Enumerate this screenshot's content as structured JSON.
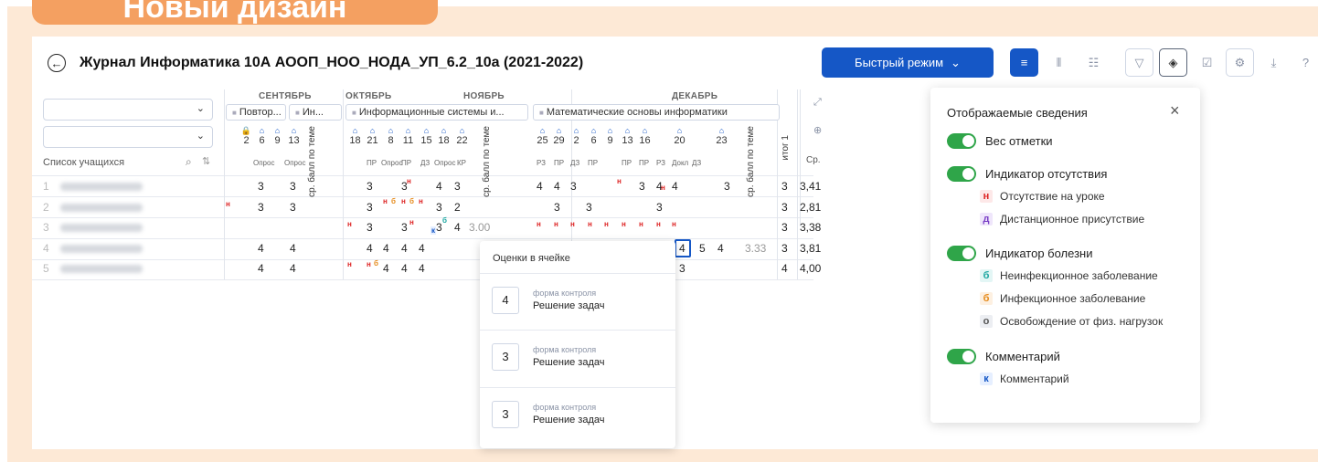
{
  "banner": {
    "text": "Новый дизайн"
  },
  "header": {
    "title": "Журнал Информатика 10А АООП_НОО_НОДА_УП_6.2_10а (2021-2022)",
    "fast_mode_label": "Быстрый режим"
  },
  "left": {
    "students_label": "Список учащихся",
    "rows": [
      {
        "num": "1"
      },
      {
        "num": "2"
      },
      {
        "num": "3"
      },
      {
        "num": "4"
      },
      {
        "num": "5"
      }
    ]
  },
  "months": [
    "СЕНТЯБРЬ",
    "ОКТЯБРЬ",
    "НОЯБРЬ",
    "ДЕКАБРЬ"
  ],
  "topics": [
    "Повтор...",
    "Ин...",
    "Информационные системы и...",
    "Математические основы информатики"
  ],
  "dates": [
    "2",
    "6",
    "9",
    "13",
    "18",
    "21",
    "8",
    "11",
    "15",
    "18",
    "22",
    "25",
    "29",
    "2",
    "6",
    "9",
    "13",
    "16",
    "20",
    "23"
  ],
  "control_forms": [
    "Опрос",
    "Опрос",
    "ПР",
    "Опрос",
    "ПР",
    "ДЗ",
    "Опрос",
    "КР",
    "РЗ",
    "ПР",
    "ДЗ",
    "ПР",
    "ПР",
    "ПР",
    "РЗ",
    "Докл",
    "ДЗ"
  ],
  "vertical_labels": {
    "theme_avg": "ср. балл по теме",
    "total": "итог 1",
    "avg": "Ср."
  },
  "grades": {
    "r1": [
      "3",
      "3",
      "3",
      "3",
      "4",
      "3",
      "4",
      "4",
      "3",
      "3",
      "4",
      "4",
      "3",
      "3"
    ],
    "r2": [
      "3",
      "3",
      "3",
      "3",
      "2",
      "3",
      "3",
      "3",
      "3"
    ],
    "r3": [
      "3",
      "3",
      "3",
      "4",
      "3.00",
      "3"
    ],
    "r4": [
      "4",
      "4",
      "4",
      "4",
      "4",
      "4",
      "4",
      "5",
      "4",
      "3.33",
      "3"
    ],
    "r5": [
      "4",
      "4",
      "4",
      "4",
      "4",
      "3",
      "4"
    ]
  },
  "averages": [
    "3,41",
    "2,81",
    "3,38",
    "3,81",
    "4,00"
  ],
  "popover": {
    "title": "Оценки в ячейке",
    "items": [
      {
        "value": "4",
        "label": "форма контроля",
        "type": "Решение задач"
      },
      {
        "value": "3",
        "label": "форма контроля",
        "type": "Решение задач"
      },
      {
        "value": "3",
        "label": "форма контроля",
        "type": "Решение задач"
      }
    ]
  },
  "settings": {
    "title": "Отображаемые сведения",
    "weight": "Вес отметки",
    "absence": "Индикатор отсутствия",
    "absence_items": [
      {
        "icon": "н",
        "label": "Отсутствие на уроке"
      },
      {
        "icon": "д",
        "label": "Дистанционное присутствие"
      }
    ],
    "illness": "Индикатор болезни",
    "illness_items": [
      {
        "icon": "б",
        "label": "Неинфекционное заболевание"
      },
      {
        "icon": "б",
        "label": "Инфекционное заболевание"
      },
      {
        "icon": "о",
        "label": "Освобождение от физ. нагрузок"
      }
    ],
    "comment": "Комментарий",
    "comment_items": [
      {
        "icon": "к",
        "label": "Комментарий"
      }
    ]
  },
  "colors": {
    "accent": "#1557c6",
    "banner": "#f4a061",
    "frame": "#fde9d6",
    "toggle": "#2fa549"
  }
}
